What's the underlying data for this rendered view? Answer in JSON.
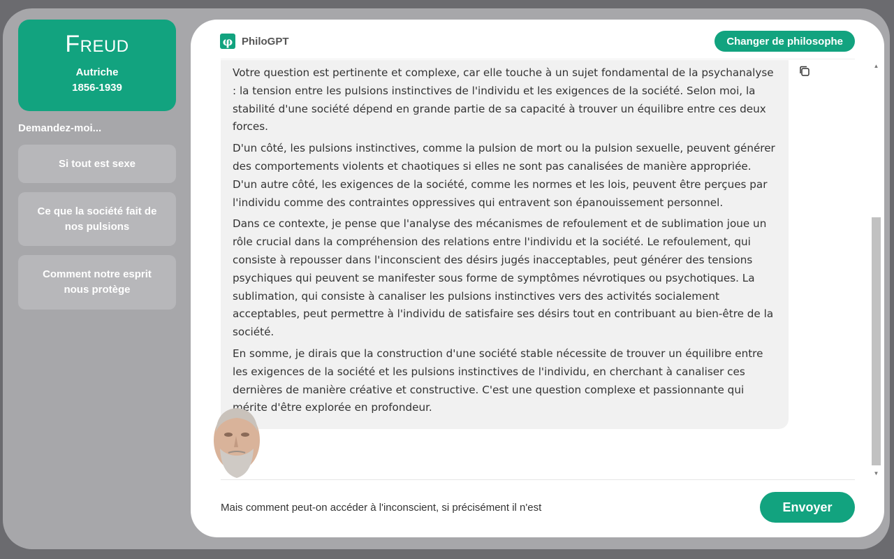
{
  "sidebar": {
    "profile": {
      "name": "Freud",
      "country": "Autriche",
      "years": "1856-1939"
    },
    "ask_label": "Demandez-moi...",
    "suggestions": [
      "Si tout est sexe",
      "Ce que la société fait de nos pulsions",
      "Comment notre esprit nous protège"
    ]
  },
  "header": {
    "brand": "PhiloGPT",
    "logo_glyph": "φ",
    "change_button": "Changer de philosophe"
  },
  "chat": {
    "message_paragraphs": [
      "Votre question est pertinente et complexe, car elle touche à un sujet fondamental de la psychanalyse : la tension entre les pulsions instinctives de l'individu et les exigences de la société. Selon moi, la stabilité d'une société dépend en grande partie de sa capacité à trouver un équilibre entre ces deux forces.",
      "D'un côté, les pulsions instinctives, comme la pulsion de mort ou la pulsion sexuelle, peuvent générer des comportements violents et chaotiques si elles ne sont pas canalisées de manière appropriée. D'un autre côté, les exigences de la société, comme les normes et les lois, peuvent être perçues par l'individu comme des contraintes oppressives qui entravent son épanouissement personnel.",
      "Dans ce contexte, je pense que l'analyse des mécanismes de refoulement et de sublimation joue un rôle crucial dans la compréhension des relations entre l'individu et la société. Le refoulement, qui consiste à repousser dans l'inconscient des désirs jugés inacceptables, peut générer des tensions psychiques qui peuvent se manifester sous forme de symptômes névrotiques ou psychotiques. La sublimation, qui consiste à canaliser les pulsions instinctives vers des activités socialement acceptables, peut permettre à l'individu de satisfaire ses désirs tout en contribuant au bien-être de la société.",
      "En somme, je dirais que la construction d'une société stable nécessite de trouver un équilibre entre les exigences de la société et les pulsions instinctives de l'individu, en cherchant à canaliser ces dernières de manière créative et constructive. C'est une question complexe et passionnante qui mérite d'être explorée en profondeur."
    ]
  },
  "composer": {
    "input_value": "Mais comment peut-on accéder à l'inconscient, si précisément il n'est",
    "send_button": "Envoyer"
  },
  "colors": {
    "accent": "#12a37f",
    "frame": "#a7a7aa",
    "bubble": "#f1f1f1"
  },
  "icons": [
    "copy-icon",
    "philo-logo-icon",
    "scroll-up-icon",
    "scroll-down-icon"
  ]
}
